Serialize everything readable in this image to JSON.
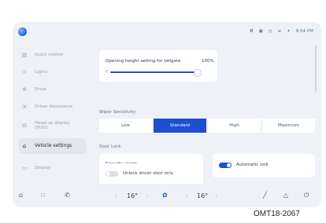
{
  "status": {
    "icons": [
      "profile-icon",
      "camera-icon",
      "timer-icon",
      "signal-icon",
      "bluetooth-icon"
    ],
    "time": "8:54 PM"
  },
  "sidebar": {
    "items": [
      {
        "label": "Quick control",
        "icon": "quick-control-icon",
        "active": false
      },
      {
        "label": "Lights",
        "icon": "light-icon",
        "active": false
      },
      {
        "label": "Drive",
        "icon": "steering-wheel-icon",
        "active": false
      },
      {
        "label": "Driver Assistance",
        "icon": "driver-assist-icon",
        "active": false
      },
      {
        "label": "Head-up display (HUD)",
        "icon": "hud-icon",
        "active": false
      },
      {
        "label": "Vehicle settings",
        "icon": "car-icon",
        "active": true
      },
      {
        "label": "Display",
        "icon": "display-icon",
        "active": false
      }
    ]
  },
  "main": {
    "tailgate": {
      "label": "Opening height setting for tailgate",
      "value": "100%",
      "level": 1.0
    },
    "wiper": {
      "title": "Wiper Sensitivity",
      "options": [
        "Low",
        "Standard",
        "High",
        "Maximum"
      ],
      "selected": "Standard"
    },
    "door_lock": {
      "title": "Door Lock",
      "security_alarm": "Security alarm",
      "automatic_lock": {
        "label": "Automatic lock",
        "on": true
      },
      "unlock_driver": {
        "label": "Unlock driver door only",
        "on": false
      }
    }
  },
  "bottom": {
    "left_temp": "16°",
    "right_temp": "16°",
    "left_arrow": "‹",
    "right_arrow": "›"
  },
  "caption": "OMT18-2067",
  "colors": {
    "accent": "#1f4fd0",
    "background": "#eef1f5"
  }
}
